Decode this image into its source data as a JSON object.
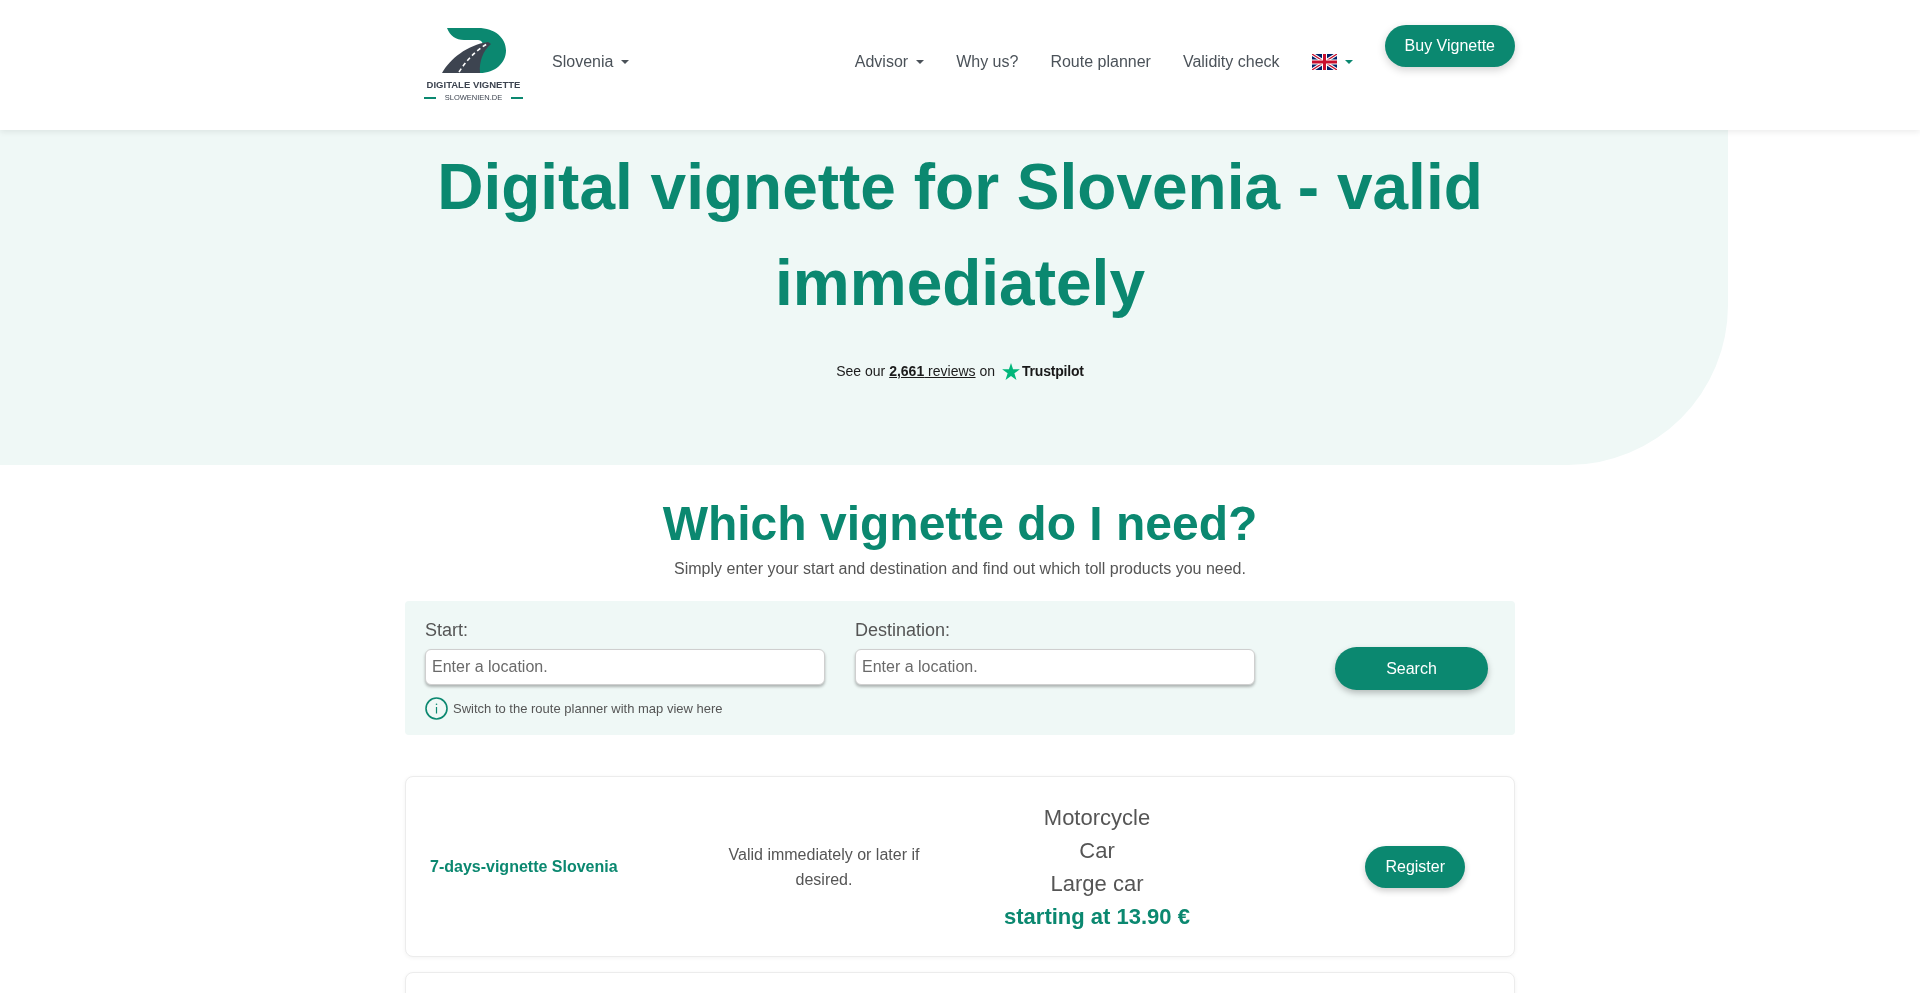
{
  "header": {
    "logo": {
      "title": "DIGITALE VIGNETTE",
      "domain": "SLOWENIEN.DE"
    },
    "country_menu": "Slovenia",
    "nav": [
      {
        "label": "Advisor",
        "kind": "dropdown"
      },
      {
        "label": "Why us?",
        "kind": "link"
      },
      {
        "label": "Route planner",
        "kind": "link"
      },
      {
        "label": "Validity check",
        "kind": "link"
      }
    ],
    "buy_button": "Buy Vignette"
  },
  "hero": {
    "title": "Digital vignette for Slovenia - valid immediately",
    "reviews": {
      "before": "See our",
      "link": "**2,661** reviews",
      "after": "on",
      "platform": "Trustpilot"
    }
  },
  "route_finder": {
    "title": "Which vignette do I need?",
    "subtitle": "Simply enter your start and destination and find out which toll products you need.",
    "start": {
      "label": "Start:",
      "placeholder": "Enter a location."
    },
    "destination": {
      "label": "Destination:",
      "placeholder": "Enter a location."
    },
    "search_button": "Search",
    "hint": "Switch to the route planner with map view here"
  },
  "products": [
    {
      "name": "7-days-vignette Slovenia",
      "description": "Valid immediately or later if desired.",
      "vehicles": [
        "Motorcycle",
        "Car",
        "Large car"
      ],
      "price": "starting at 13.90 €",
      "button": "Register"
    }
  ]
}
